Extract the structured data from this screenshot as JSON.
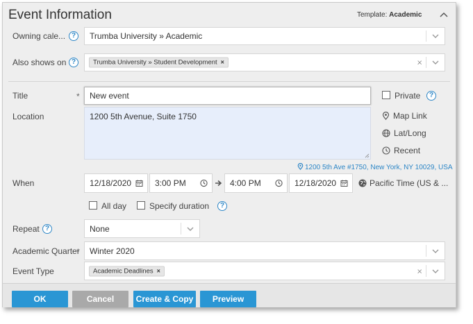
{
  "header": {
    "title": "Event Information",
    "template_label": "Template:",
    "template_value": "Academic"
  },
  "owning_calendar": {
    "label": "Owning cale...",
    "value": "Trumba University » Academic"
  },
  "also_shows_on": {
    "label": "Also shows on",
    "tag": "Trumba University » Student Development",
    "clear": "×"
  },
  "title": {
    "label": "Title",
    "required": "*",
    "value": "New event"
  },
  "location": {
    "label": "Location",
    "value": "1200 5th Avenue, Suite 1750"
  },
  "side": {
    "private": "Private",
    "map_link": "Map Link",
    "latlong": "Lat/Long",
    "recent": "Recent"
  },
  "address_link": "1200 5th Ave #1750, New York, NY 10029, USA",
  "when": {
    "label": "When",
    "start_date": "12/18/2020",
    "start_time": "3:00 PM",
    "end_time": "4:00 PM",
    "end_date": "12/18/2020",
    "timezone": "Pacific Time (US & ...",
    "all_day": "All day",
    "specify_duration": "Specify duration"
  },
  "repeat": {
    "label": "Repeat",
    "value": "None"
  },
  "academic_quarter": {
    "label": "Academic Quarter",
    "required": "*",
    "value": "Winter 2020"
  },
  "event_type": {
    "label": "Event Type",
    "tag": "Academic Deadlines",
    "clear": "×"
  },
  "footer": {
    "ok": "OK",
    "cancel": "Cancel",
    "create_copy": "Create & Copy",
    "preview": "Preview"
  },
  "help_glyph": "?",
  "tag_remove": "×",
  "colors": {
    "accent": "#2a96d4",
    "link": "#2d86c6",
    "location_bg": "#e7eefb"
  }
}
